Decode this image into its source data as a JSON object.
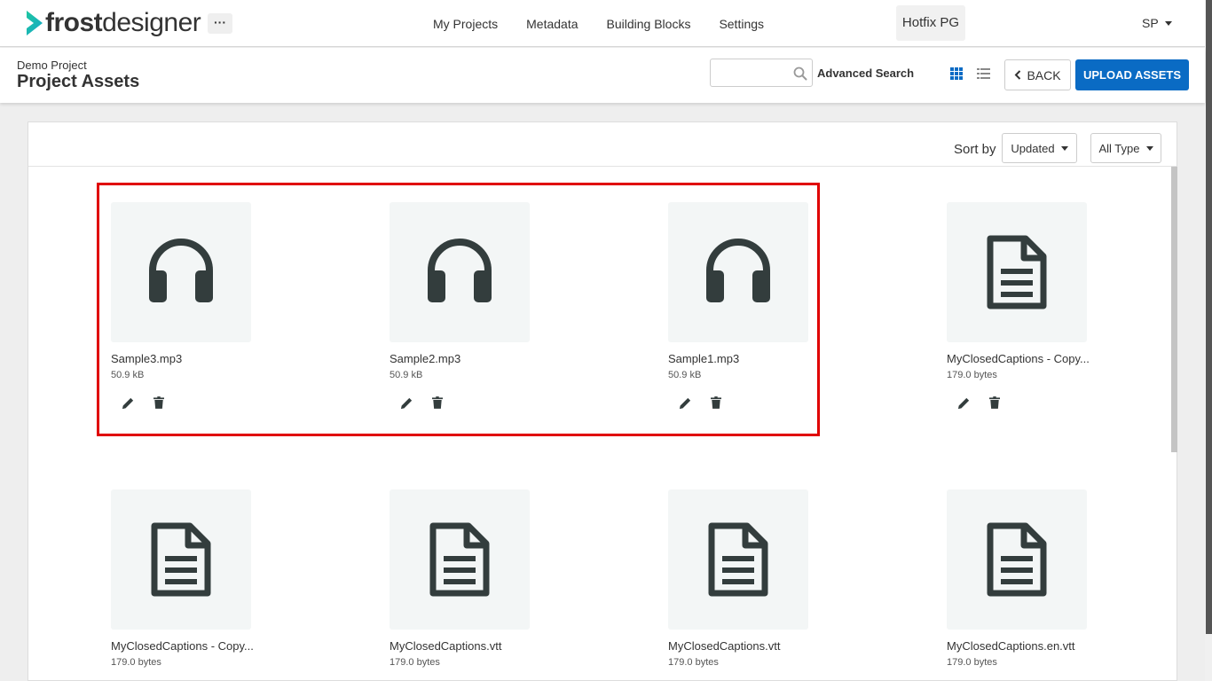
{
  "app": {
    "logo_bold": "frost",
    "logo_light": "designer",
    "more_label": "···",
    "nav": [
      "My Projects",
      "Metadata",
      "Building Blocks",
      "Settings"
    ],
    "env_label": "Hotfix PG",
    "user_initials": "SP"
  },
  "header": {
    "breadcrumb": "Demo Project",
    "title": "Project Assets",
    "search_value": "",
    "search_placeholder": "",
    "advanced_search": "Advanced Search",
    "back_label": "BACK",
    "upload_label": "UPLOAD ASSETS"
  },
  "toolbar": {
    "sort_label": "Sort by",
    "sort_value": "Updated",
    "type_value": "All Type"
  },
  "assets": [
    {
      "name": "Sample3.mp3",
      "size": "50.9 kB",
      "icon": "headphones-icon"
    },
    {
      "name": "Sample2.mp3",
      "size": "50.9 kB",
      "icon": "headphones-icon"
    },
    {
      "name": "Sample1.mp3",
      "size": "50.9 kB",
      "icon": "headphones-icon"
    },
    {
      "name": "MyClosedCaptions - Copy...",
      "size": "179.0 bytes",
      "icon": "document-icon"
    },
    {
      "name": "MyClosedCaptions - Copy...",
      "size": "179.0 bytes",
      "icon": "document-icon"
    },
    {
      "name": "MyClosedCaptions.vtt",
      "size": "179.0 bytes",
      "icon": "document-icon"
    },
    {
      "name": "MyClosedCaptions.vtt",
      "size": "179.0 bytes",
      "icon": "document-icon"
    },
    {
      "name": "MyClosedCaptions.en.vtt",
      "size": "179.0 bytes",
      "icon": "document-icon"
    }
  ],
  "colors": {
    "accent": "#0a6bc4",
    "logo_accent": "#1ec6a0",
    "highlight": "#e00000",
    "icon": "#333d3d"
  }
}
